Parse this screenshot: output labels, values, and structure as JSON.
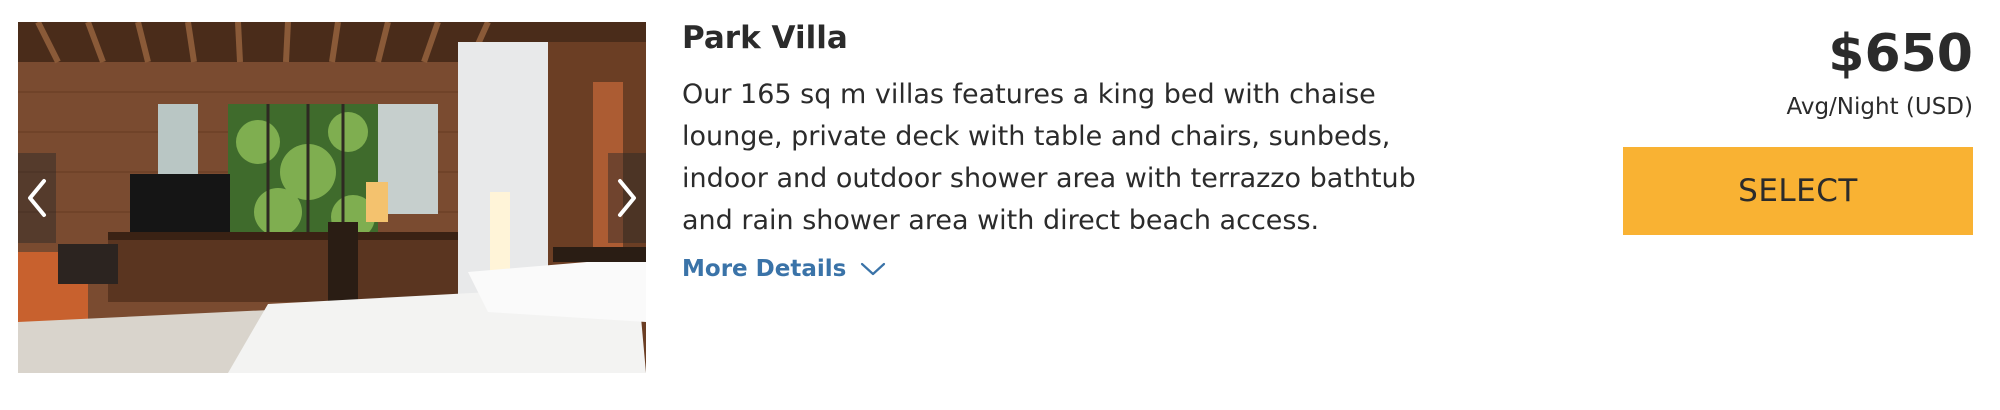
{
  "room": {
    "name": "Park Villa",
    "description": "Our 165 sq m villas features a king bed with chaise lounge, private deck with table and chairs, sunbeds, indoor and outdoor shower area with terrazzo bathtub and rain shower area with direct beach access.",
    "more_details_label": "More Details"
  },
  "pricing": {
    "price": "$650",
    "rate_note": "Avg/Night (USD)",
    "select_label": "SELECT"
  },
  "gallery": {
    "prev_icon": "chevron-left-icon",
    "next_icon": "chevron-right-icon"
  },
  "colors": {
    "select_button": "#f9b233",
    "link": "#3a73a8",
    "text": "#2b2b2b"
  }
}
